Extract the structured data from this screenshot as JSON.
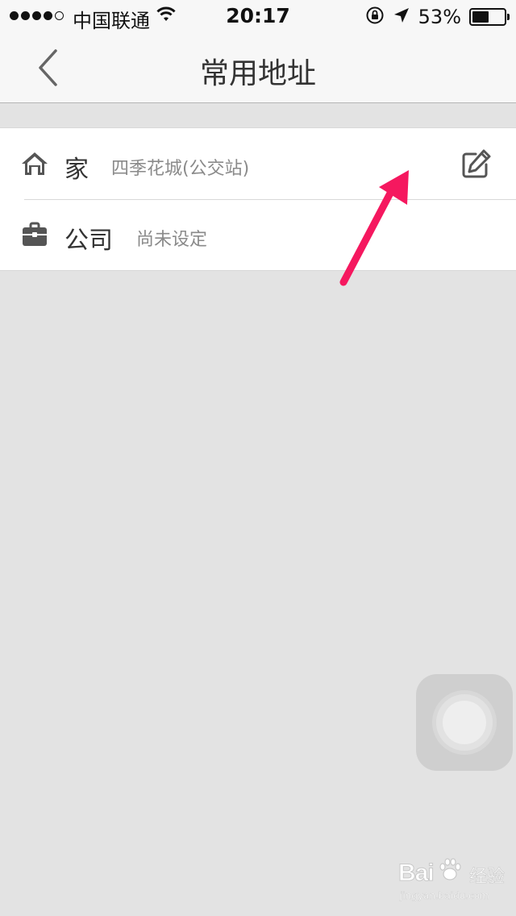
{
  "status_bar": {
    "carrier": "中国联通",
    "time": "20:17",
    "battery_percent_label": "53%",
    "battery_level": 0.53,
    "signal_bars_filled": 4,
    "signal_bars_total": 5
  },
  "nav": {
    "title": "常用地址",
    "back_icon": "chevron-left-icon"
  },
  "addresses": [
    {
      "label": "家",
      "value": "四季花城(公交站)",
      "icon": "home-icon",
      "has_edit": true,
      "edit_icon": "edit-pencil-icon"
    },
    {
      "label": "公司",
      "value": "尚未设定",
      "icon": "briefcase-icon",
      "has_edit": false
    }
  ],
  "annotation": {
    "arrow_color": "#f5185f"
  },
  "watermark": {
    "brand": "Bai",
    "brand_suffix": "经验",
    "url": "jingyan.baidu.com"
  },
  "colors": {
    "background": "#e3e3e3",
    "nav_background": "#f7f7f7",
    "row_background": "#ffffff",
    "label_text": "#333333",
    "value_text": "#8a8a8a",
    "icon_gray": "#555555"
  }
}
